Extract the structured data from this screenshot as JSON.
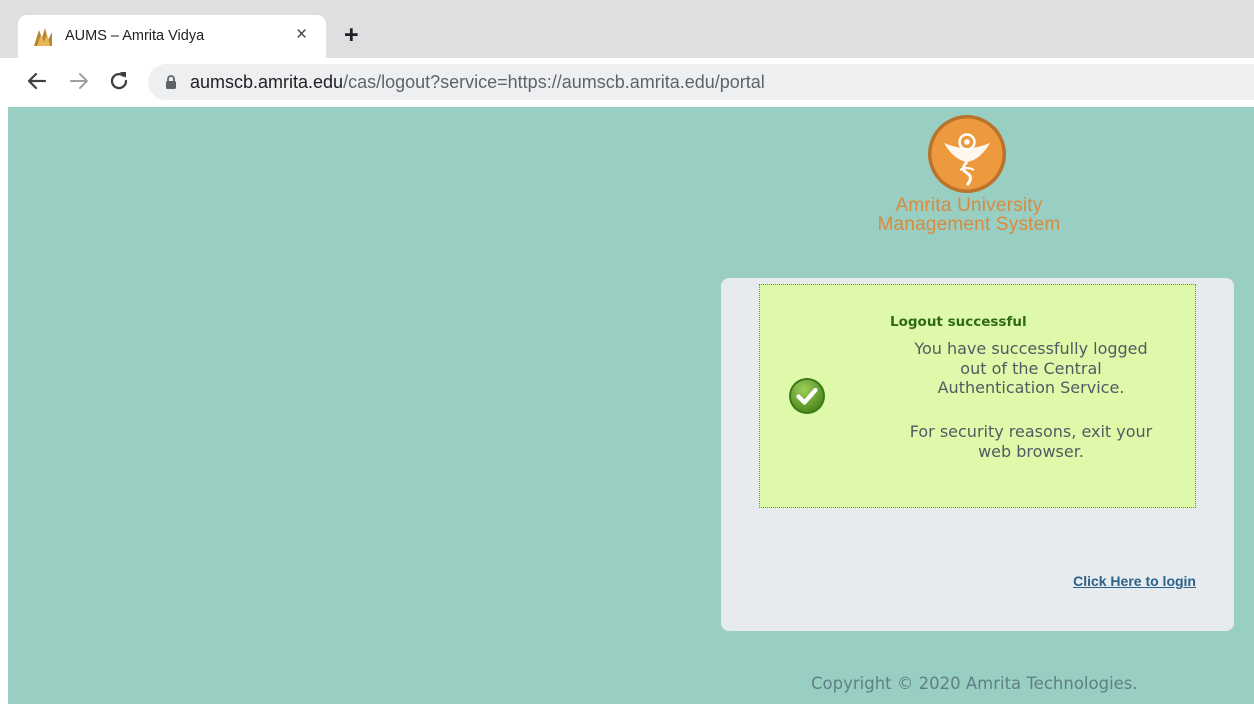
{
  "browser": {
    "tab_title": "AUMS – Amrita Vidya",
    "tab_close": "×",
    "new_tab": "+",
    "url_host": "aumscb.amrita.edu",
    "url_path": "/cas/logout?service=https://aumscb.amrita.edu/portal"
  },
  "header": {
    "brand_line1": "Amrita University",
    "brand_line2": "Management System",
    "brand_color": "#d88a3e"
  },
  "message": {
    "title": "Logout successful",
    "line1": "You have successfully logged",
    "line2": "out of the Central",
    "line3": "Authentication Service.",
    "security_line1": "For security reasons, exit your",
    "security_line2": "web browser.",
    "status_icon": "check-circle-icon"
  },
  "login_link": "Click Here to login",
  "footer": {
    "copyright": "Copyright © 2020 Amrita Technologies."
  },
  "colors": {
    "page_bg": "#99cfc2",
    "panel_bg": "#e8ebee",
    "message_bg": "#dff9aa",
    "link": "#2a6289"
  }
}
